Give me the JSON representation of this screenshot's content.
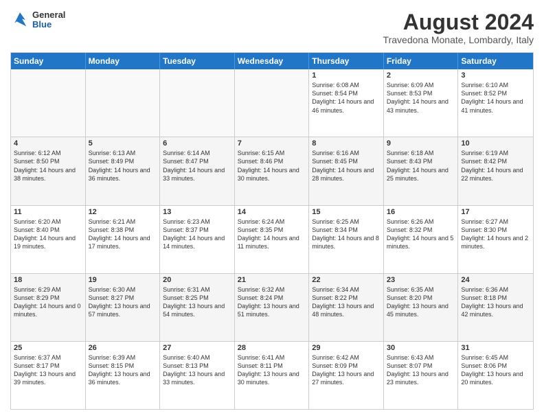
{
  "logo": {
    "general": "General",
    "blue": "Blue"
  },
  "title": {
    "month_year": "August 2024",
    "location": "Travedona Monate, Lombardy, Italy"
  },
  "days_of_week": [
    "Sunday",
    "Monday",
    "Tuesday",
    "Wednesday",
    "Thursday",
    "Friday",
    "Saturday"
  ],
  "weeks": [
    [
      {
        "day": "",
        "info": ""
      },
      {
        "day": "",
        "info": ""
      },
      {
        "day": "",
        "info": ""
      },
      {
        "day": "",
        "info": ""
      },
      {
        "day": "1",
        "info": "Sunrise: 6:08 AM\nSunset: 8:54 PM\nDaylight: 14 hours and 46 minutes."
      },
      {
        "day": "2",
        "info": "Sunrise: 6:09 AM\nSunset: 8:53 PM\nDaylight: 14 hours and 43 minutes."
      },
      {
        "day": "3",
        "info": "Sunrise: 6:10 AM\nSunset: 8:52 PM\nDaylight: 14 hours and 41 minutes."
      }
    ],
    [
      {
        "day": "4",
        "info": "Sunrise: 6:12 AM\nSunset: 8:50 PM\nDaylight: 14 hours and 38 minutes."
      },
      {
        "day": "5",
        "info": "Sunrise: 6:13 AM\nSunset: 8:49 PM\nDaylight: 14 hours and 36 minutes."
      },
      {
        "day": "6",
        "info": "Sunrise: 6:14 AM\nSunset: 8:47 PM\nDaylight: 14 hours and 33 minutes."
      },
      {
        "day": "7",
        "info": "Sunrise: 6:15 AM\nSunset: 8:46 PM\nDaylight: 14 hours and 30 minutes."
      },
      {
        "day": "8",
        "info": "Sunrise: 6:16 AM\nSunset: 8:45 PM\nDaylight: 14 hours and 28 minutes."
      },
      {
        "day": "9",
        "info": "Sunrise: 6:18 AM\nSunset: 8:43 PM\nDaylight: 14 hours and 25 minutes."
      },
      {
        "day": "10",
        "info": "Sunrise: 6:19 AM\nSunset: 8:42 PM\nDaylight: 14 hours and 22 minutes."
      }
    ],
    [
      {
        "day": "11",
        "info": "Sunrise: 6:20 AM\nSunset: 8:40 PM\nDaylight: 14 hours and 19 minutes."
      },
      {
        "day": "12",
        "info": "Sunrise: 6:21 AM\nSunset: 8:38 PM\nDaylight: 14 hours and 17 minutes."
      },
      {
        "day": "13",
        "info": "Sunrise: 6:23 AM\nSunset: 8:37 PM\nDaylight: 14 hours and 14 minutes."
      },
      {
        "day": "14",
        "info": "Sunrise: 6:24 AM\nSunset: 8:35 PM\nDaylight: 14 hours and 11 minutes."
      },
      {
        "day": "15",
        "info": "Sunrise: 6:25 AM\nSunset: 8:34 PM\nDaylight: 14 hours and 8 minutes."
      },
      {
        "day": "16",
        "info": "Sunrise: 6:26 AM\nSunset: 8:32 PM\nDaylight: 14 hours and 5 minutes."
      },
      {
        "day": "17",
        "info": "Sunrise: 6:27 AM\nSunset: 8:30 PM\nDaylight: 14 hours and 2 minutes."
      }
    ],
    [
      {
        "day": "18",
        "info": "Sunrise: 6:29 AM\nSunset: 8:29 PM\nDaylight: 14 hours and 0 minutes."
      },
      {
        "day": "19",
        "info": "Sunrise: 6:30 AM\nSunset: 8:27 PM\nDaylight: 13 hours and 57 minutes."
      },
      {
        "day": "20",
        "info": "Sunrise: 6:31 AM\nSunset: 8:25 PM\nDaylight: 13 hours and 54 minutes."
      },
      {
        "day": "21",
        "info": "Sunrise: 6:32 AM\nSunset: 8:24 PM\nDaylight: 13 hours and 51 minutes."
      },
      {
        "day": "22",
        "info": "Sunrise: 6:34 AM\nSunset: 8:22 PM\nDaylight: 13 hours and 48 minutes."
      },
      {
        "day": "23",
        "info": "Sunrise: 6:35 AM\nSunset: 8:20 PM\nDaylight: 13 hours and 45 minutes."
      },
      {
        "day": "24",
        "info": "Sunrise: 6:36 AM\nSunset: 8:18 PM\nDaylight: 13 hours and 42 minutes."
      }
    ],
    [
      {
        "day": "25",
        "info": "Sunrise: 6:37 AM\nSunset: 8:17 PM\nDaylight: 13 hours and 39 minutes."
      },
      {
        "day": "26",
        "info": "Sunrise: 6:39 AM\nSunset: 8:15 PM\nDaylight: 13 hours and 36 minutes."
      },
      {
        "day": "27",
        "info": "Sunrise: 6:40 AM\nSunset: 8:13 PM\nDaylight: 13 hours and 33 minutes."
      },
      {
        "day": "28",
        "info": "Sunrise: 6:41 AM\nSunset: 8:11 PM\nDaylight: 13 hours and 30 minutes."
      },
      {
        "day": "29",
        "info": "Sunrise: 6:42 AM\nSunset: 8:09 PM\nDaylight: 13 hours and 27 minutes."
      },
      {
        "day": "30",
        "info": "Sunrise: 6:43 AM\nSunset: 8:07 PM\nDaylight: 13 hours and 23 minutes."
      },
      {
        "day": "31",
        "info": "Sunrise: 6:45 AM\nSunset: 8:06 PM\nDaylight: 13 hours and 20 minutes."
      }
    ]
  ]
}
